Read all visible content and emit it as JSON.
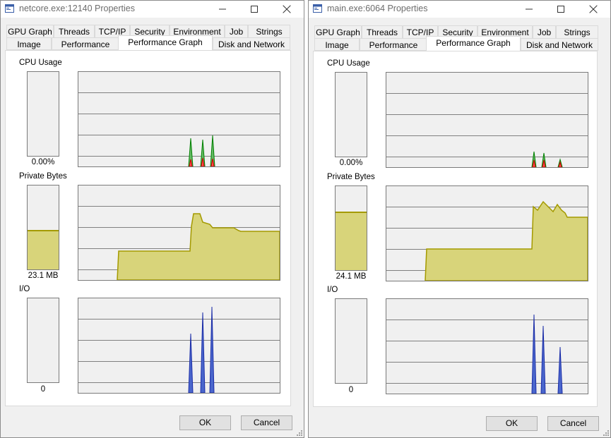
{
  "windows": [
    {
      "title": "netcore.exe:12140 Properties",
      "tabs_row1": [
        "GPU Graph",
        "Threads",
        "TCP/IP",
        "Security",
        "Environment",
        "Job",
        "Strings"
      ],
      "tabs_row2": [
        "Image",
        "Performance",
        "Performance Graph",
        "Disk and Network"
      ],
      "active_tab": "Performance Graph",
      "sections": [
        {
          "label": "CPU Usage",
          "value": "0.00%",
          "meter_fraction": 0.0
        },
        {
          "label": "Private Bytes",
          "value": "23.1 MB",
          "meter_fraction": 0.45
        },
        {
          "label": "I/O",
          "value": "0",
          "meter_fraction": 0.0
        }
      ],
      "ok_label": "OK",
      "cancel_label": "Cancel"
    },
    {
      "title": "main.exe:6064 Properties",
      "tabs_row1": [
        "GPU Graph",
        "Threads",
        "TCP/IP",
        "Security",
        "Environment",
        "Job",
        "Strings"
      ],
      "tabs_row2": [
        "Image",
        "Performance",
        "Performance Graph",
        "Disk and Network"
      ],
      "active_tab": "Performance Graph",
      "sections": [
        {
          "label": "CPU Usage",
          "value": "0.00%",
          "meter_fraction": 0.0
        },
        {
          "label": "Private Bytes",
          "value": "24.1 MB",
          "meter_fraction": 0.68
        },
        {
          "label": "I/O",
          "value": "0",
          "meter_fraction": 0.0
        }
      ],
      "ok_label": "OK",
      "cancel_label": "Cancel"
    }
  ],
  "colors": {
    "cpu_kernel": "#d00000",
    "cpu_total": "#008000",
    "memory_fill": "#d8d47a",
    "memory_line": "#a49a00",
    "io_fill": "#4a66cc",
    "io_line": "#1c2ea8",
    "grid": "#808080"
  },
  "icons": [
    "app-window-icon",
    "minimize-icon",
    "maximize-icon",
    "close-icon",
    "resize-grip-icon"
  ]
}
